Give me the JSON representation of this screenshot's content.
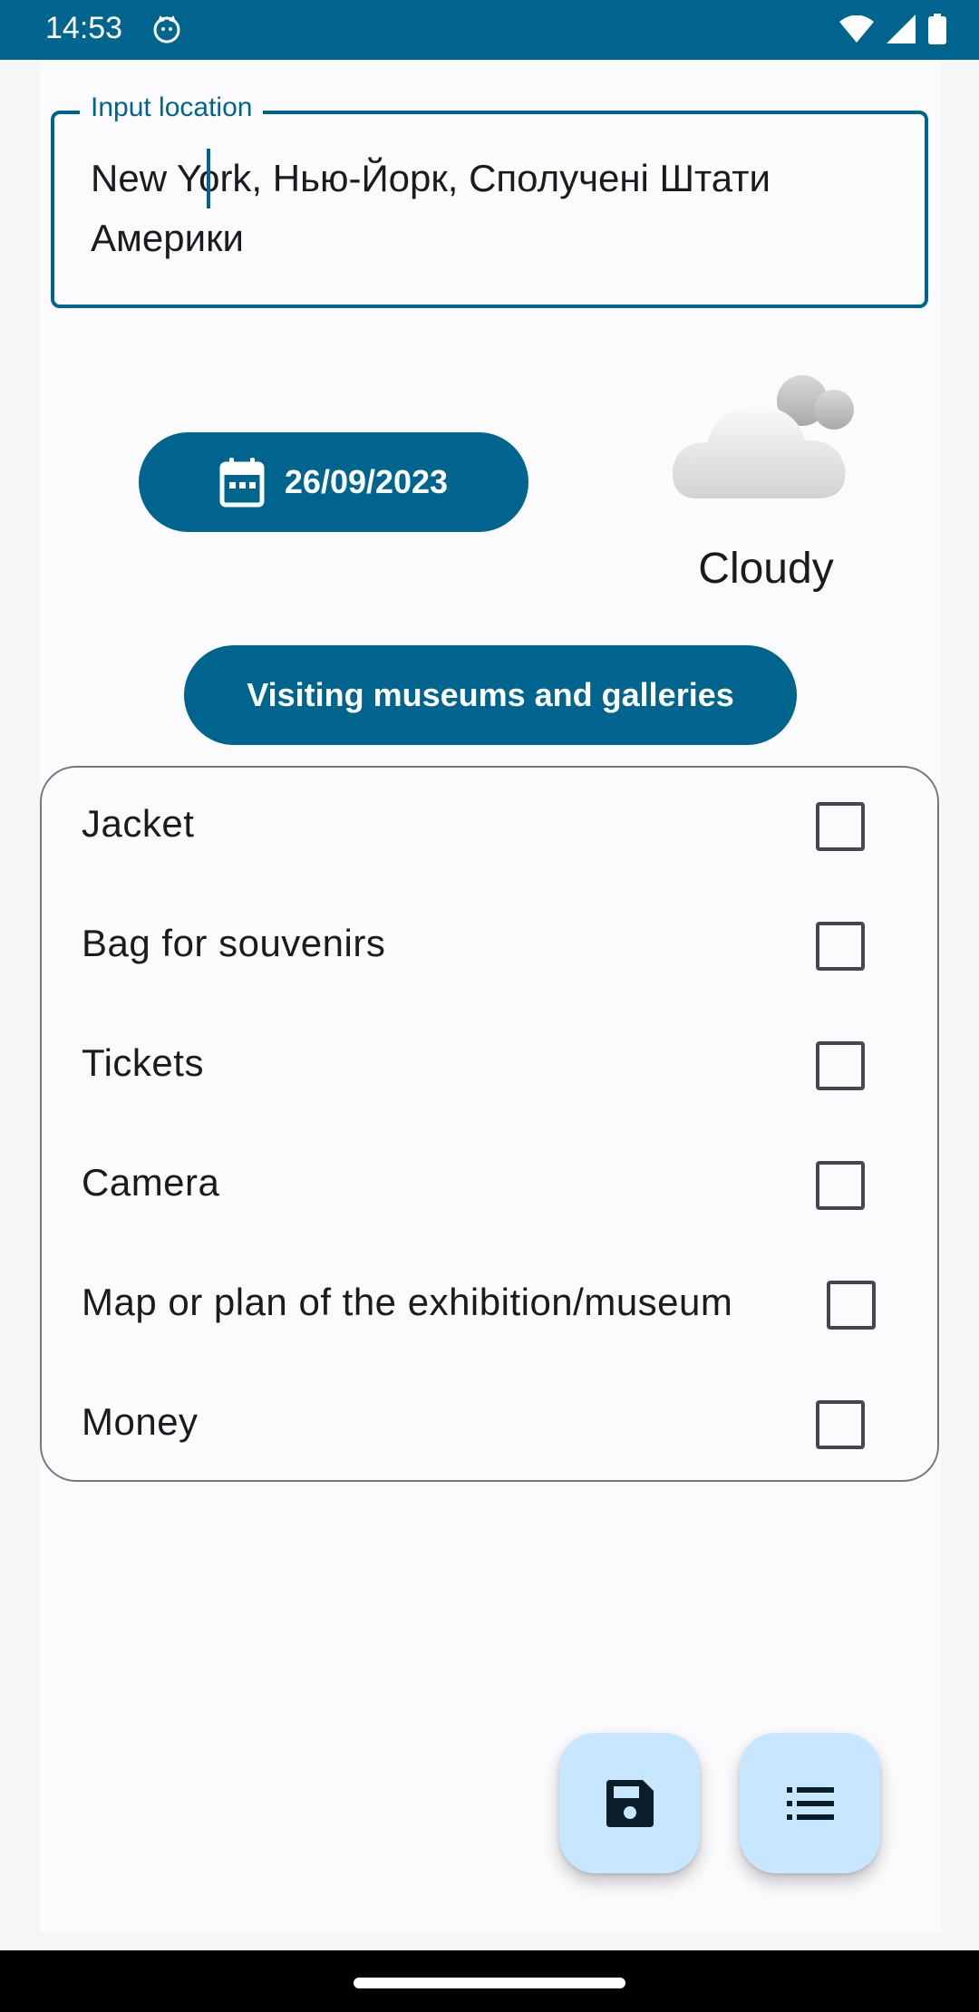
{
  "status_bar": {
    "time": "14:53",
    "background": "#00658e",
    "icons": [
      "cat-notification-icon",
      "wifi-icon",
      "signal-icon",
      "battery-icon"
    ]
  },
  "location_field": {
    "label": "Input location",
    "value": "New York, Нью-Йорк, Сполучені Штати Америки"
  },
  "date_button": {
    "label": "26/09/2023",
    "icon": "calendar-icon"
  },
  "weather": {
    "icon": "cloud-icon",
    "label": "Cloudy"
  },
  "activity_button": {
    "label": "Visiting museums and galleries"
  },
  "checklist": {
    "items": [
      {
        "label": "Jacket",
        "checked": false
      },
      {
        "label": "Bag for souvenirs",
        "checked": false
      },
      {
        "label": "Tickets",
        "checked": false
      },
      {
        "label": "Camera",
        "checked": false
      },
      {
        "label": "Map or plan of the exhibition/museum",
        "checked": false
      },
      {
        "label": "Money",
        "checked": false
      }
    ]
  },
  "fabs": {
    "save_icon": "save-icon",
    "list_icon": "list-icon"
  },
  "colors": {
    "primary": "#00658e",
    "fab_container": "#c6e7ff",
    "outline": "#75777f"
  }
}
